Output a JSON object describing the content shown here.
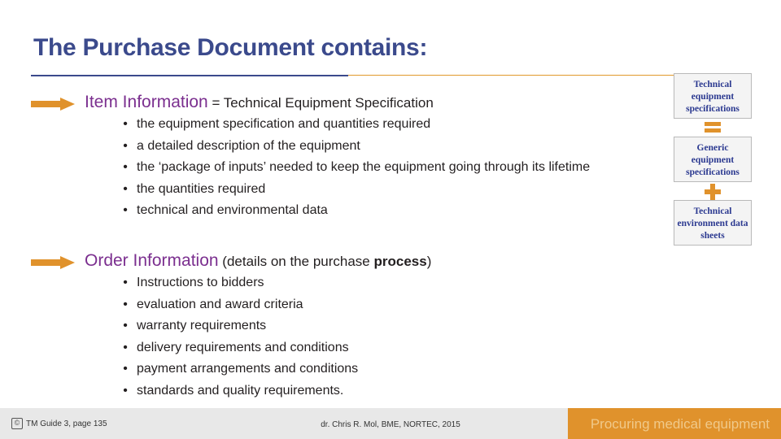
{
  "slide": {
    "title": "The Purchase Document contains:",
    "sections": [
      {
        "heading_key": "Item Information",
        "heading_rest_pre": " = Technical Equipment Specification",
        "bullets": [
          "the equipment specification and quantities required",
          "a detailed description of the equipment",
          "the ‘package of inputs’ needed to keep the equipment going through its lifetime",
          "the quantities required",
          "technical and environmental data"
        ]
      },
      {
        "heading_key": "Order Information",
        "heading_rest_pre": " (details on the purchase ",
        "heading_rest_bold": "process",
        "heading_rest_post": ")",
        "bullets": [
          "Instructions to bidders",
          "evaluation and award criteria",
          "warranty requirements",
          "delivery requirements and conditions",
          "payment arrangements and conditions",
          "standards and quality requirements."
        ]
      }
    ],
    "graphic": {
      "box1": "Technical equipment specifications",
      "box2": "Generic equipment specifications",
      "box3": "Technical environment data sheets",
      "operator1": "equals-sign",
      "operator2": "plus-sign"
    },
    "footer": {
      "left": "TM Guide 3, page 135",
      "center": "dr. Chris R. Mol, BME, NORTEC, 2015",
      "right": "Procuring medical equipment"
    },
    "colors": {
      "title": "#3b4a8c",
      "accent_orange": "#e0922c",
      "heading_purple": "#7b2f8f",
      "footer_bg": "#e8e8e8"
    }
  }
}
